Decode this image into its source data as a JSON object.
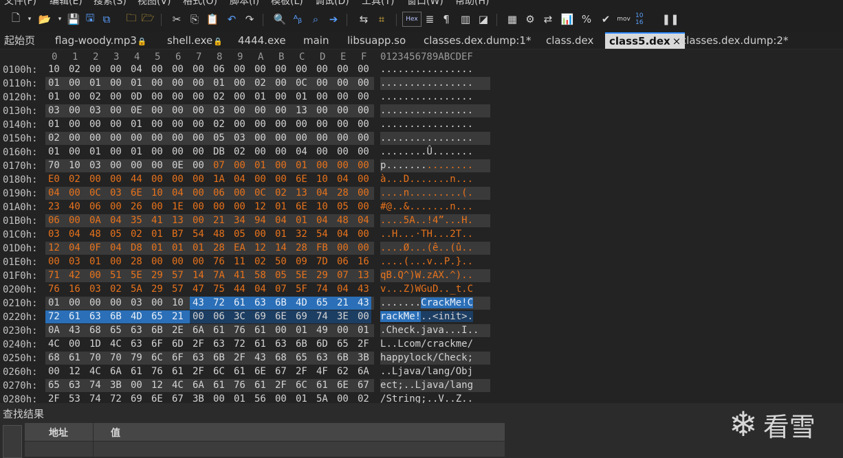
{
  "menu": [
    "文件(F)",
    "编辑(E)",
    "搜索(S)",
    "视图(V)",
    "格式(O)",
    "脚本(I)",
    "模板(L)",
    "调试(D)",
    "工具(T)",
    "窗口(W)",
    "帮助(H)"
  ],
  "toolbar": {
    "hex_label": "Hex",
    "mov_label": "mov",
    "base_label": "10 16"
  },
  "tabs": [
    {
      "label": "起始页",
      "locked": false
    },
    {
      "label": "flag-woody.mp3",
      "locked": true
    },
    {
      "label": "shell.exe",
      "locked": true
    },
    {
      "label": "4444.exe",
      "locked": false
    },
    {
      "label": "main",
      "locked": false
    },
    {
      "label": "libsuapp.so",
      "locked": false
    },
    {
      "label": "classes.dex.dump:1*",
      "locked": false
    },
    {
      "label": "class.dex",
      "locked": false
    },
    {
      "label": "class5.dex",
      "locked": false,
      "active": true,
      "close": "×"
    },
    {
      "label": "classes.dex.dump:2*",
      "locked": false
    }
  ],
  "hex_view": {
    "column_headers": [
      "0",
      "1",
      "2",
      "3",
      "4",
      "5",
      "6",
      "7",
      "8",
      "9",
      "A",
      "B",
      "C",
      "D",
      "E",
      "F"
    ],
    "ascii_header": "0123456789ABCDEF",
    "rows": [
      {
        "addr": "0100h:",
        "bytes": [
          "10",
          "02",
          "00",
          "00",
          "04",
          "00",
          "00",
          "00",
          "06",
          "00",
          "00",
          "00",
          "00",
          "00",
          "00",
          "00"
        ],
        "ascii": "................"
      },
      {
        "addr": "0110h:",
        "bytes": [
          "01",
          "00",
          "01",
          "00",
          "01",
          "00",
          "00",
          "00",
          "01",
          "00",
          "02",
          "00",
          "0C",
          "00",
          "00",
          "00"
        ],
        "ascii": "................"
      },
      {
        "addr": "0120h:",
        "bytes": [
          "01",
          "00",
          "02",
          "00",
          "0D",
          "00",
          "00",
          "00",
          "02",
          "00",
          "01",
          "00",
          "01",
          "00",
          "00",
          "00"
        ],
        "ascii": "................"
      },
      {
        "addr": "0130h:",
        "bytes": [
          "03",
          "00",
          "03",
          "00",
          "0E",
          "00",
          "00",
          "00",
          "03",
          "00",
          "00",
          "00",
          "13",
          "00",
          "00",
          "00"
        ],
        "ascii": "................"
      },
      {
        "addr": "0140h:",
        "bytes": [
          "01",
          "00",
          "00",
          "00",
          "01",
          "00",
          "00",
          "00",
          "02",
          "00",
          "00",
          "00",
          "00",
          "00",
          "00",
          "00"
        ],
        "ascii": "................"
      },
      {
        "addr": "0150h:",
        "bytes": [
          "02",
          "00",
          "00",
          "00",
          "00",
          "00",
          "00",
          "00",
          "05",
          "03",
          "00",
          "00",
          "00",
          "00",
          "00",
          "00"
        ],
        "ascii": "................"
      },
      {
        "addr": "0160h:",
        "bytes": [
          "01",
          "00",
          "01",
          "00",
          "01",
          "00",
          "00",
          "00",
          "DB",
          "02",
          "00",
          "00",
          "04",
          "00",
          "00",
          "00"
        ],
        "ascii": "........Û......."
      },
      {
        "addr": "0170h:",
        "bytes": [
          "70",
          "10",
          "03",
          "00",
          "00",
          "00",
          "0E",
          "00",
          "07",
          "00",
          "01",
          "00",
          "01",
          "00",
          "00",
          "00"
        ],
        "ascii": "p..............."
      },
      {
        "addr": "0180h:",
        "bytes": [
          "E0",
          "02",
          "00",
          "00",
          "44",
          "00",
          "00",
          "00",
          "1A",
          "04",
          "00",
          "00",
          "6E",
          "10",
          "04",
          "00"
        ],
        "ascii": "à...D.......n..."
      },
      {
        "addr": "0190h:",
        "bytes": [
          "04",
          "00",
          "0C",
          "03",
          "6E",
          "10",
          "04",
          "00",
          "06",
          "00",
          "0C",
          "02",
          "13",
          "04",
          "28",
          "00"
        ],
        "ascii": "....n.........(."
      },
      {
        "addr": "01A0h:",
        "bytes": [
          "23",
          "40",
          "06",
          "00",
          "26",
          "00",
          "1E",
          "00",
          "00",
          "00",
          "12",
          "01",
          "6E",
          "10",
          "05",
          "00"
        ],
        "ascii": "#@..&.......n..."
      },
      {
        "addr": "01B0h:",
        "bytes": [
          "06",
          "00",
          "0A",
          "04",
          "35",
          "41",
          "13",
          "00",
          "21",
          "34",
          "94",
          "04",
          "01",
          "04",
          "48",
          "04"
        ],
        "ascii": "....5A..!4”...H."
      },
      {
        "addr": "01C0h:",
        "bytes": [
          "03",
          "04",
          "48",
          "05",
          "02",
          "01",
          "B7",
          "54",
          "48",
          "05",
          "00",
          "01",
          "32",
          "54",
          "04",
          "00"
        ],
        "ascii": "..H...·TH...2T.."
      },
      {
        "addr": "01D0h:",
        "bytes": [
          "12",
          "04",
          "0F",
          "04",
          "D8",
          "01",
          "01",
          "01",
          "28",
          "EA",
          "12",
          "14",
          "28",
          "FB",
          "00",
          "00"
        ],
        "ascii": "....Ø...(ê..(û.."
      },
      {
        "addr": "01E0h:",
        "bytes": [
          "00",
          "03",
          "01",
          "00",
          "28",
          "00",
          "00",
          "00",
          "76",
          "11",
          "02",
          "50",
          "09",
          "7D",
          "06",
          "16"
        ],
        "ascii": "....(...v..P.}.."
      },
      {
        "addr": "01F0h:",
        "bytes": [
          "71",
          "42",
          "00",
          "51",
          "5E",
          "29",
          "57",
          "14",
          "7A",
          "41",
          "58",
          "05",
          "5E",
          "29",
          "07",
          "13"
        ],
        "ascii": "qB.Q^)W.zAX.^).."
      },
      {
        "addr": "0200h:",
        "bytes": [
          "76",
          "16",
          "03",
          "02",
          "5A",
          "29",
          "57",
          "47",
          "75",
          "44",
          "04",
          "07",
          "5F",
          "74",
          "04",
          "43"
        ],
        "ascii": "v...Z)WGuD.._t.C"
      },
      {
        "addr": "0210h:",
        "bytes": [
          "01",
          "00",
          "00",
          "00",
          "03",
          "00",
          "10",
          "43",
          "72",
          "61",
          "63",
          "6B",
          "4D",
          "65",
          "21",
          "43"
        ],
        "ascii": ".......CrackMe!C"
      },
      {
        "addr": "0220h:",
        "bytes": [
          "72",
          "61",
          "63",
          "6B",
          "4D",
          "65",
          "21",
          "00",
          "06",
          "3C",
          "69",
          "6E",
          "69",
          "74",
          "3E",
          "00"
        ],
        "ascii": "rackMe!..<init>."
      },
      {
        "addr": "0230h:",
        "bytes": [
          "0A",
          "43",
          "68",
          "65",
          "63",
          "6B",
          "2E",
          "6A",
          "61",
          "76",
          "61",
          "00",
          "01",
          "49",
          "00",
          "01"
        ],
        "ascii": ".Check.java...I.."
      },
      {
        "addr": "0240h:",
        "bytes": [
          "4C",
          "00",
          "1D",
          "4C",
          "63",
          "6F",
          "6D",
          "2F",
          "63",
          "72",
          "61",
          "63",
          "6B",
          "6D",
          "65",
          "2F"
        ],
        "ascii": "L..Lcom/crackme/"
      },
      {
        "addr": "0250h:",
        "bytes": [
          "68",
          "61",
          "70",
          "70",
          "79",
          "6C",
          "6F",
          "63",
          "6B",
          "2F",
          "43",
          "68",
          "65",
          "63",
          "6B",
          "3B"
        ],
        "ascii": "happylock/Check;"
      },
      {
        "addr": "0260h:",
        "bytes": [
          "00",
          "12",
          "4C",
          "6A",
          "61",
          "76",
          "61",
          "2F",
          "6C",
          "61",
          "6E",
          "67",
          "2F",
          "4F",
          "62",
          "6A"
        ],
        "ascii": "..Ljava/lang/Obj"
      },
      {
        "addr": "0270h:",
        "bytes": [
          "65",
          "63",
          "74",
          "3B",
          "00",
          "12",
          "4C",
          "6A",
          "61",
          "76",
          "61",
          "2F",
          "6C",
          "61",
          "6E",
          "67"
        ],
        "ascii": "ect;..Ljava/lang"
      },
      {
        "addr": "0280h:",
        "bytes": [
          "2F",
          "53",
          "74",
          "72",
          "69",
          "6E",
          "67",
          "3B",
          "00",
          "01",
          "56",
          "00",
          "01",
          "5A",
          "00",
          "02"
        ],
        "ascii": "/String;..V..Z.."
      }
    ]
  },
  "search_results": {
    "title": "查找结果",
    "col_address": "地址",
    "col_value": "值"
  },
  "logo": {
    "text": "看雪"
  }
}
